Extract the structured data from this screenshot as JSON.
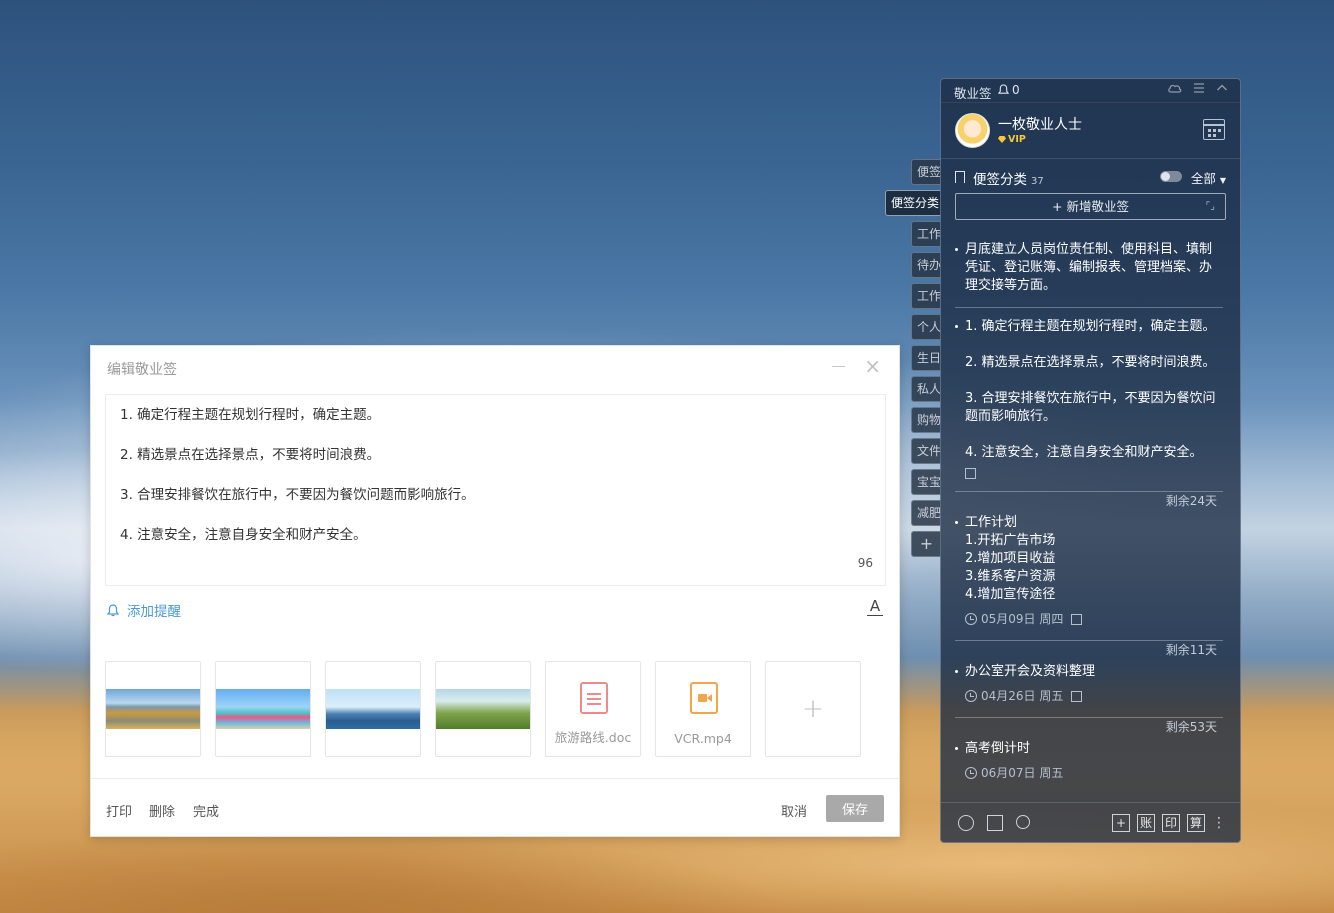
{
  "editor": {
    "title": "编辑敬业签",
    "body_lines": [
      "1. 确定行程主题在规划行程时，确定主题。",
      "2. 精选景点在选择景点，不要将时间浪费。",
      "3. 合理安排餐饮在旅行中，不要因为餐饮问题而影响旅行。",
      "4. 注意安全，注意自身安全和财产安全。"
    ],
    "char_count": "96",
    "reminder_label": "添加提醒",
    "font_icon": "A",
    "attachments": [
      {
        "type": "image",
        "icon": "landscape-road-image"
      },
      {
        "type": "image",
        "icon": "group-photo-image"
      },
      {
        "type": "image",
        "icon": "sea-boats-image"
      },
      {
        "type": "image",
        "icon": "meadow-girl-image"
      },
      {
        "type": "file",
        "name": "旅游路线.doc",
        "icon": "doc-file-icon"
      },
      {
        "type": "file",
        "name": "VCR.mp4",
        "icon": "video-file-icon"
      }
    ],
    "add_symbol": "+",
    "footer": {
      "print": "打印",
      "delete": "删除",
      "done": "完成",
      "cancel": "取消",
      "save": "保存"
    },
    "close_symbol": "×"
  },
  "tabs": [
    {
      "label": "便签",
      "active": false
    },
    {
      "label": "便签分类",
      "active": true
    },
    {
      "label": "工作",
      "active": false
    },
    {
      "label": "待办",
      "active": false
    },
    {
      "label": "工作",
      "active": false
    },
    {
      "label": "个人",
      "active": false
    },
    {
      "label": "生日",
      "active": false
    },
    {
      "label": "私人",
      "active": false
    },
    {
      "label": "购物",
      "active": false
    },
    {
      "label": "文件",
      "active": false
    },
    {
      "label": "宝宝",
      "active": false
    },
    {
      "label": "减肥",
      "active": false
    },
    {
      "label": "+",
      "active": false
    }
  ],
  "panel": {
    "app_name": "敬业签",
    "notification_count": "0",
    "user_name": "一枚敬业人士",
    "vip": "VIP",
    "category_label": "便签分类",
    "category_count": "37",
    "filter": "全部",
    "new_button": "+ 新增敬业签",
    "notes": [
      {
        "lines": [
          "月底建立人员岗位责任制、使用科目、填制凭证、登记账簿、编制报表、管理档案、办理交接等方面。"
        ]
      },
      {
        "lines": [
          "1. 确定行程主题在规划行程时，确定主题。",
          "2. 精选景点在选择景点，不要将时间浪费。",
          "3. 合理安排餐饮在旅行中，不要因为餐饮问题而影响旅行。",
          "4. 注意安全，注意自身安全和财产安全。"
        ]
      },
      {
        "remain": "剩余24天",
        "lines": [
          "工作计划",
          "1.开拓广告市场",
          "2.增加项目收益",
          "3.维系客户资源",
          "4.增加宣传途径"
        ],
        "date": "05月09日 周四"
      },
      {
        "remain": "剩余11天",
        "lines": [
          "办公室开会及资料整理"
        ],
        "date": "04月26日 周五"
      },
      {
        "remain": "剩余53天",
        "lines": [
          "高考倒计时"
        ],
        "date": "06月07日 周五"
      }
    ],
    "bottom_right": [
      "+",
      "账",
      "印",
      "算"
    ]
  },
  "colors": {
    "accent_link": "#4c9bd8",
    "save_button": "#a9a9a9",
    "vip_gold": "#f7c934",
    "panel_bg": "#1c2c42"
  }
}
